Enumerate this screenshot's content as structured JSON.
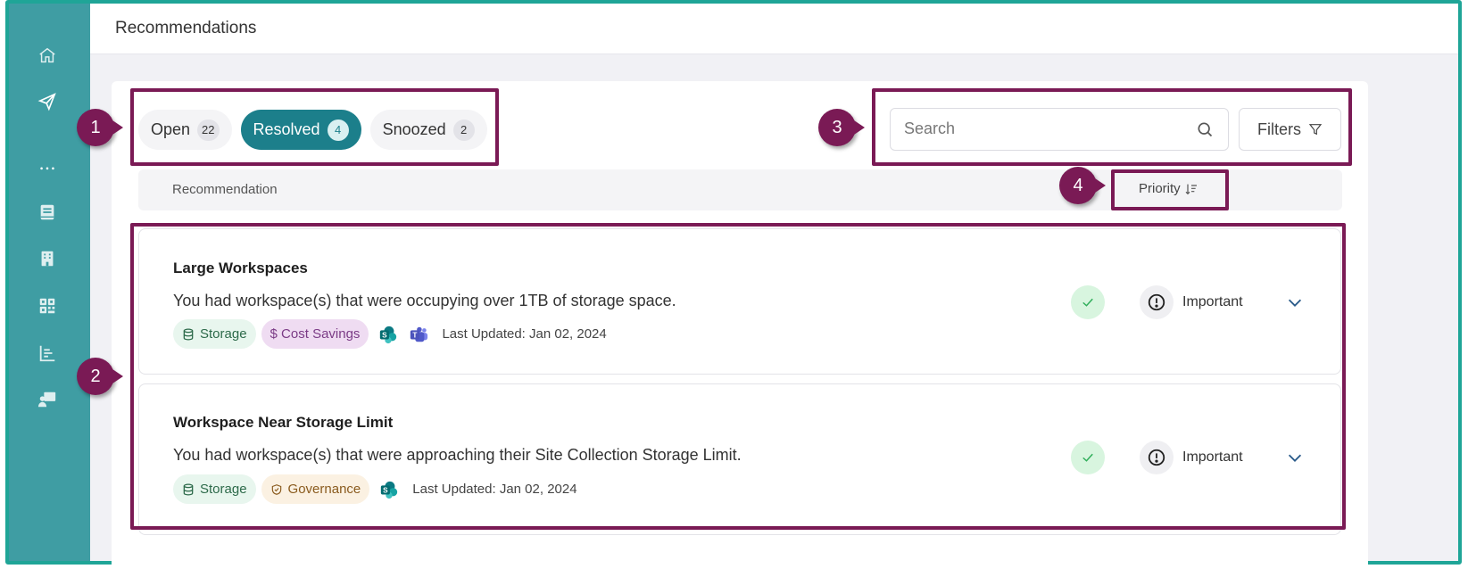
{
  "page": {
    "title": "Recommendations"
  },
  "tabs": [
    {
      "label": "Open",
      "count": "22"
    },
    {
      "label": "Resolved",
      "count": "4"
    },
    {
      "label": "Snoozed",
      "count": "2"
    }
  ],
  "search": {
    "placeholder": "Search"
  },
  "filters": {
    "label": "Filters"
  },
  "table": {
    "col_recommendation": "Recommendation",
    "col_priority": "Priority"
  },
  "recommendations": [
    {
      "title": "Large Workspaces",
      "description": "You had workspace(s) that were occupying over 1TB of storage space.",
      "tags": [
        "Storage",
        "$ Cost Savings"
      ],
      "apps": [
        "sharepoint-icon",
        "teams-icon"
      ],
      "updated": "Last Updated: Jan 02, 2024",
      "priority": "Important"
    },
    {
      "title": "Workspace Near Storage Limit",
      "description": "You had workspace(s) that were approaching their Site Collection Storage Limit.",
      "tags": [
        "Storage",
        "Governance"
      ],
      "apps": [
        "sharepoint-icon"
      ],
      "updated": "Last Updated: Jan 02, 2024",
      "priority": "Important"
    }
  ],
  "callouts": [
    "1",
    "2",
    "3",
    "4"
  ],
  "colors": {
    "sidebar": "#3f9da3",
    "accent": "#1c7f8b",
    "callout": "#7a1a55",
    "frame": "#1fa597"
  }
}
